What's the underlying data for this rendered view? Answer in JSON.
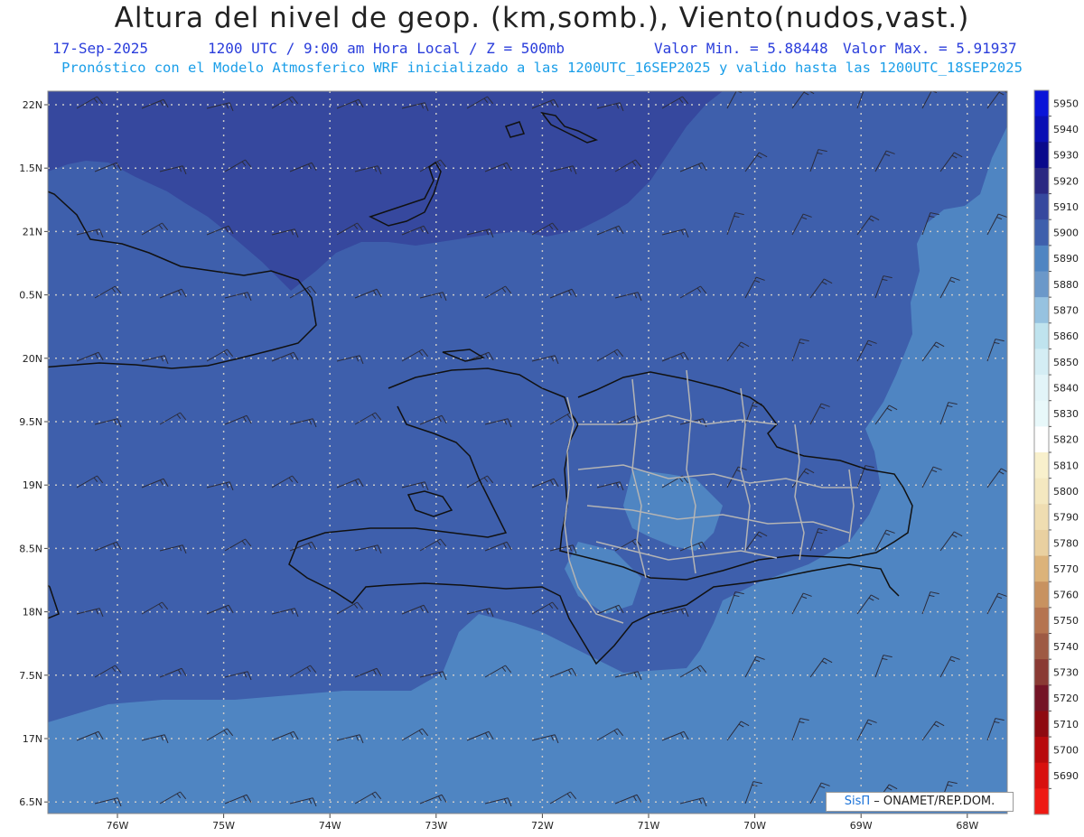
{
  "header": {
    "title": "Altura del nivel de geop. (km,somb.), Viento(nudos,vast.)",
    "date": "17-Sep-2025",
    "time": "1200 UTC / 9:00 am Hora Local / Z = 500mb",
    "min": "Valor Min. = 5.88448",
    "max": "Valor Max. = 5.91937",
    "forecast": "Pronóstico con el Modelo Atmosferico WRF inicializado a las 1200UTC_16SEP2025 y valido hasta las  1200UTC_18SEP2025"
  },
  "colors": {
    "z5920": "#2a2882",
    "z5910": "#36489e",
    "z5900": "#3e5fac",
    "z5890": "#4f85c2",
    "z5880": "#6b98c9"
  },
  "axes": {
    "lat_labels": [
      "22N",
      "1.5N",
      "21N",
      "0.5N",
      "20N",
      "9.5N",
      "19N",
      "8.5N",
      "18N",
      "7.5N",
      "17N",
      "6.5N"
    ],
    "lon_labels": [
      "76W",
      "75W",
      "74W",
      "73W",
      "72W",
      "71W",
      "70W",
      "69W",
      "68W"
    ]
  },
  "colorbar": {
    "labels": [
      "5950",
      "5940",
      "5930",
      "5920",
      "5910",
      "5900",
      "5890",
      "5880",
      "5870",
      "5860",
      "5850",
      "5840",
      "5830",
      "5820",
      "5810",
      "5800",
      "5790",
      "5780",
      "5770",
      "5760",
      "5750",
      "5740",
      "5730",
      "5720",
      "5710",
      "5700",
      "5690"
    ],
    "colors": [
      "#0a14d8",
      "#0a0fb4",
      "#0a0a8c",
      "#2a2882",
      "#36489e",
      "#3e5fac",
      "#4f85c2",
      "#6b98c9",
      "#96c2e0",
      "#bfe3ee",
      "#d4edf4",
      "#e2f4f8",
      "#e8f8fa",
      "#ffffff",
      "#f8f0cc",
      "#f4e8c0",
      "#efddb1",
      "#e9d0a0",
      "#dcb37a",
      "#c89260",
      "#b57450",
      "#9e5a44",
      "#8a3a34",
      "#741426",
      "#8e0a10",
      "#b80a0c",
      "#d8100e",
      "#ee1a14"
    ]
  },
  "credit": {
    "logo": "SisΠ",
    "text": "– ONAMET/REP.DOM."
  }
}
